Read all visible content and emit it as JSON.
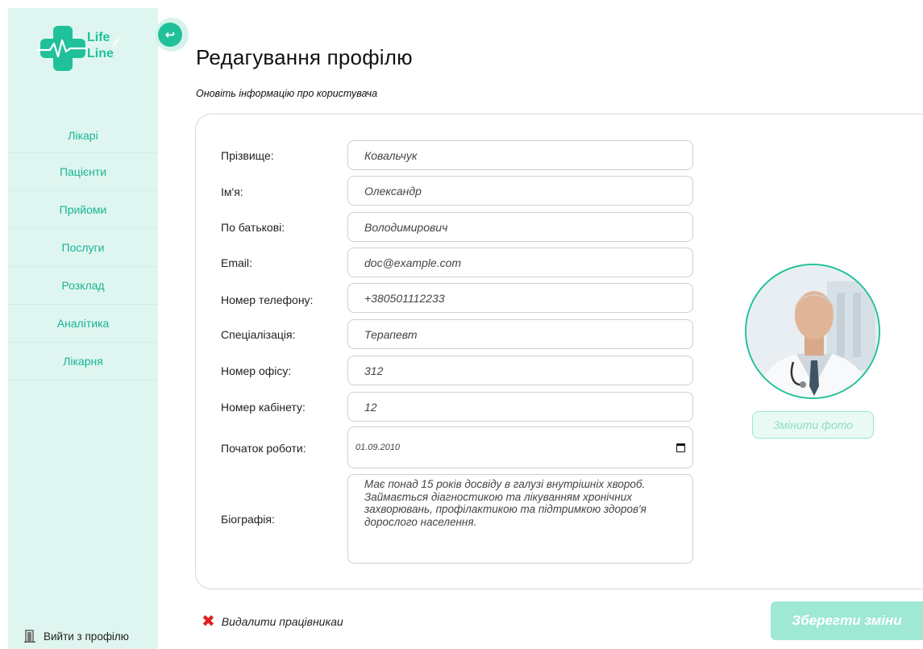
{
  "brand": {
    "line1": "Life",
    "line2": "Line"
  },
  "nav": {
    "items": [
      "Лікарі",
      "Пацієнти",
      "Прийоми",
      "Послуги",
      "Розклад",
      "Аналітика",
      "Лікарня"
    ]
  },
  "logout_label": "Вийти з профілю",
  "header": {
    "title": "Редагування профілю",
    "subtitle": "Оновіть інформацію про користувача"
  },
  "form": {
    "last_name": {
      "label": "Прізвище:",
      "value": "Ковальчук"
    },
    "first_name": {
      "label": "Ім'я:",
      "value": "Олександр"
    },
    "middle_name": {
      "label": "По батькові:",
      "value": "Володимирович"
    },
    "email": {
      "label": "Email:",
      "value": "doc@example.com"
    },
    "phone": {
      "label": "Номер телефону:",
      "value": "+380501112233"
    },
    "specialization": {
      "label": "Спеціалізація:",
      "value": "Терапевт"
    },
    "office": {
      "label": "Номер офісу:",
      "value": "312"
    },
    "cabinet": {
      "label": "Номер кабінету:",
      "value": "12"
    },
    "start_date": {
      "label": "Початок роботи:",
      "value": "01.09.2010"
    },
    "bio": {
      "label": "Біографія:",
      "value": "Має понад 15 років досвіду в галузі внутрішніх хвороб. Займається діагностикою та лікуванням хронічних захворювань, профілактикою та підтримкою здоров'я дорослого населення."
    }
  },
  "change_photo_label": "Змінити фото",
  "delete_label": "Видалити працівникаи",
  "save_label": "Зберегти зміни",
  "colors": {
    "accent": "#20c19a",
    "sidebar_bg": "#dff6f0",
    "danger": "#e02020",
    "save_disabled": "#9ee8d4"
  }
}
